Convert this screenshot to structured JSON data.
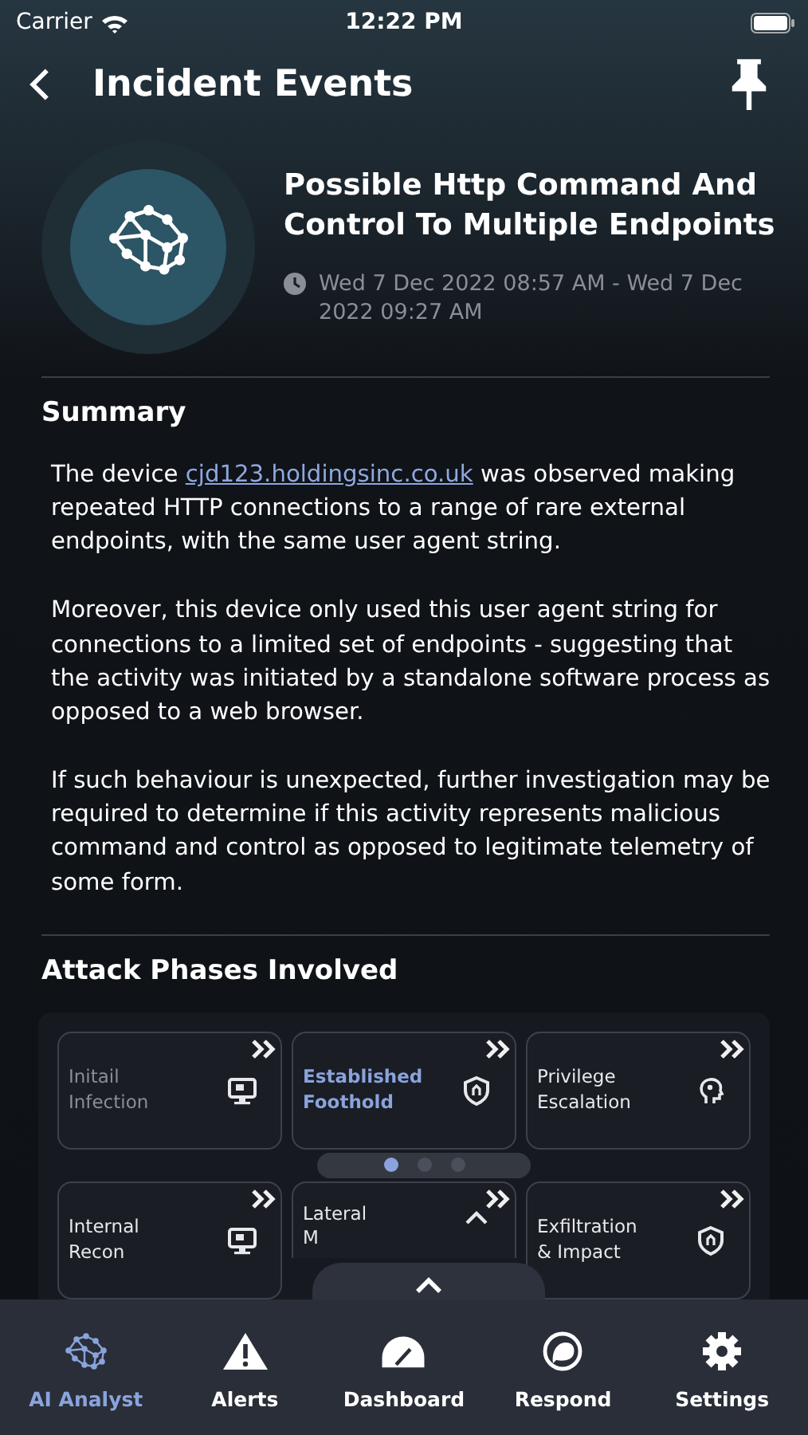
{
  "status_bar": {
    "carrier": "Carrier",
    "time": "12:22 PM"
  },
  "header": {
    "title": "Incident Events"
  },
  "incident": {
    "title": "Possible Http Command And Control To Multiple Endpoints",
    "time_range": "Wed 7 Dec 2022 08:57 AM - Wed 7 Dec 2022 09:27 AM"
  },
  "summary": {
    "heading": "Summary",
    "paragraphs": [
      {
        "before": "The device ",
        "link": "cjd123.holdingsinc.co.uk",
        "after": " was observed making repeated HTTP connections to a range of rare external endpoints, with the same user agent string."
      },
      {
        "before": "Moreover, this device only used this user agent string for connections to a limited set of endpoints - suggesting that the activity was initiated by a standalone software process as opposed to a web browser."
      },
      {
        "before": "If such behaviour is unexpected, further investigation may be required to determine if this activity represents malicious command and control as opposed to legitimate telemetry of some form."
      }
    ]
  },
  "attack_phases": {
    "heading": "Attack Phases Involved",
    "phases": [
      {
        "lines": [
          "Initail",
          "Infection"
        ],
        "kind": "monitor",
        "selected": false,
        "dimmed": true
      },
      {
        "lines": [
          "Established",
          "Foothold"
        ],
        "kind": "shield",
        "selected": true,
        "dimmed": false
      },
      {
        "lines": [
          "Privilege",
          "Escalation"
        ],
        "kind": "head",
        "selected": false,
        "dimmed": false
      },
      {
        "lines": [
          "Internal",
          "Recon"
        ],
        "kind": "monitor",
        "selected": false,
        "dimmed": false
      },
      {
        "lines": [
          "Lateral",
          "M"
        ],
        "kind": "caret",
        "selected": false,
        "dimmed": false
      },
      {
        "lines": [
          "Exfiltration",
          "& Impact"
        ],
        "kind": "shield",
        "selected": false,
        "dimmed": false
      }
    ],
    "pages": [
      {
        "selected": true
      },
      {
        "selected": false
      },
      {
        "selected": false
      }
    ]
  },
  "tab_bar": [
    {
      "label": "AI Analyst",
      "kind": "network",
      "selected": true
    },
    {
      "label": "Alerts",
      "kind": "alert",
      "selected": false
    },
    {
      "label": "Dashboard",
      "kind": "gauge",
      "selected": false
    },
    {
      "label": "Respond",
      "kind": "respond",
      "selected": false
    },
    {
      "label": "Settings",
      "kind": "gear",
      "selected": false
    }
  ]
}
